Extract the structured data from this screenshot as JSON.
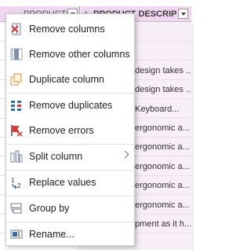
{
  "grid": {
    "col1_header": "PRODUCTSSCODE",
    "col2_header": "PRODUCT DESCRIPTION",
    "col2_type_icon": "A B C",
    "cells": [
      "",
      "",
      "design takes ...",
      "design takes ...",
      "Keyboard...",
      "ergonomic a...",
      "ergonomic a...",
      "ergonomic a...",
      "ergonomic a...",
      "ergonomic a...",
      "pment as it h...",
      ""
    ]
  },
  "menu": {
    "items": [
      {
        "label": "Remove columns",
        "icon": "remove-columns-icon"
      },
      {
        "label": "Remove other columns",
        "icon": "remove-other-columns-icon"
      },
      {
        "label": "Duplicate column",
        "icon": "duplicate-column-icon"
      },
      {
        "label": "Remove duplicates",
        "icon": "remove-duplicates-icon"
      },
      {
        "label": "Remove errors",
        "icon": "remove-errors-icon"
      },
      {
        "label": "Split column",
        "icon": "split-column-icon",
        "submenu": true
      },
      {
        "label": "Replace values",
        "icon": "replace-values-icon"
      },
      {
        "label": "Group by",
        "icon": "group-by-icon"
      },
      {
        "label": "Rename...",
        "icon": "rename-icon"
      }
    ]
  },
  "colors": {
    "header_bg": "#efd8ef",
    "selected_column_bg": "#f7eef7",
    "menu_border": "#c8c8c8",
    "icon_red": "#d83b3b",
    "icon_blue": "#2e6db4"
  }
}
